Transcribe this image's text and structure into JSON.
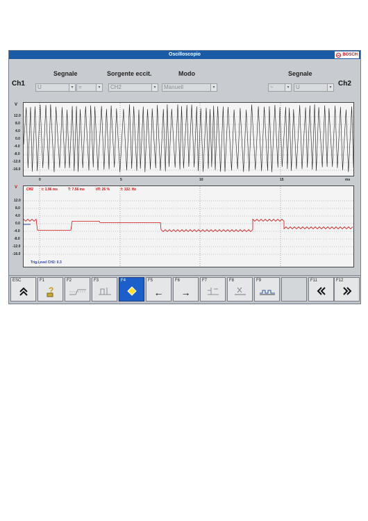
{
  "window": {
    "title": "Oscilloscopio",
    "brand": "BOSCH"
  },
  "ch1": {
    "label": "Ch1",
    "col_signal": "Segnale",
    "col_source": "Sorgente eccit.",
    "col_mode": "Modo",
    "signal_value": "U",
    "coupling_value": "=",
    "source_value": "CH2",
    "mode_value": "Manuell"
  },
  "ch2": {
    "label": "Ch2",
    "col_signal": "Segnale",
    "coupling_value": "~",
    "signal_value": "U"
  },
  "scope1": {
    "unit_y": "V",
    "unit_x": "ms",
    "y_ticks": [
      "12.0",
      "8.0",
      "4.0",
      "0.0",
      "-4.0",
      "-8.0",
      "-12.0",
      "-16.0"
    ],
    "x_ticks": [
      "0",
      "5",
      "10",
      "15"
    ]
  },
  "scope2": {
    "unit_y": "V",
    "y_ticks": [
      "12.0",
      "8.0",
      "4.0",
      "0.0",
      "-4.0",
      "-8.0",
      "-12.0",
      "-16.0"
    ],
    "info_channel": "CH2",
    "info_t1": "t: 1.96 ms",
    "info_T": "T: 7.56 ms",
    "info_duty": "t/T: 26 %",
    "info_freq": "f: 132. Hz",
    "trigger": "Trig.Level CH2: 0.3"
  },
  "colors": {
    "accent": "#1a5aa6",
    "trace2": "#d01010",
    "active_key": "#1d5fc9"
  },
  "fkeys": [
    {
      "label": "ESC",
      "icon": "double-chevron-up-icon",
      "glyph": "⌃"
    },
    {
      "label": "F1",
      "icon": "help-icon",
      "glyph": "?"
    },
    {
      "label": "F2",
      "icon": "trigger-edge-icon",
      "glyph": ""
    },
    {
      "label": "F3",
      "icon": "trigger-level-icon",
      "glyph": ""
    },
    {
      "label": "F4",
      "icon": "diamond-icon",
      "glyph": ""
    },
    {
      "label": "F5",
      "icon": "arrow-left-icon",
      "glyph": "←"
    },
    {
      "label": "F6",
      "icon": "arrow-right-icon",
      "glyph": "→"
    },
    {
      "label": "F7",
      "icon": "cursor-icon",
      "glyph": ""
    },
    {
      "label": "F8",
      "icon": "measure-x-icon",
      "glyph": "×"
    },
    {
      "label": "F9",
      "icon": "signal-icon",
      "glyph": ""
    },
    {
      "label": "",
      "icon": "",
      "glyph": ""
    },
    {
      "label": "F11",
      "icon": "double-chevron-left-icon",
      "glyph": "«"
    },
    {
      "label": "F12",
      "icon": "double-chevron-right-icon",
      "glyph": "»"
    }
  ]
}
